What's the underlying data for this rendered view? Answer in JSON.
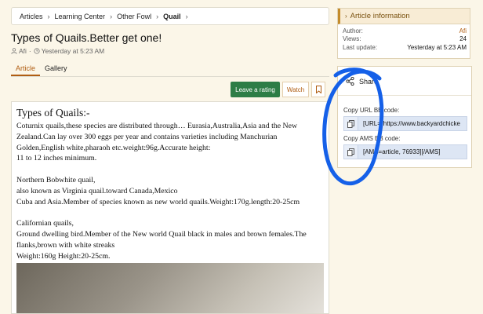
{
  "breadcrumb": {
    "items": [
      "Articles",
      "Learning Center",
      "Other Fowl"
    ],
    "current": "Quail"
  },
  "article": {
    "title": "Types of Quails.Better get one!",
    "author": "Afi",
    "date": "Yesterday at 5:23 AM",
    "tabs": [
      "Article",
      "Gallery"
    ],
    "buttons": {
      "rating": "Leave a rating",
      "watch": "Watch"
    },
    "body": {
      "heading": "Types of Quails:-",
      "paragraphs": [
        [
          "Coturnix quails,these species are distributed through… Eurasia,Australia,Asia and the New",
          "Zealand.Can lay over 300 eggs per year and contains varieties including Manchurian",
          "Golden,English white,pharaoh etc.weight:96g.Accurate height:",
          "11 to 12 inches minimum."
        ],
        [
          "Northern Bobwhite quail,",
          "also known as Virginia quail.toward Canada,Mexico",
          "Cuba and Asia.Member of species known as new world quails.Weight:170g.length:20-25cm"
        ],
        [
          "Californian quails,",
          "Ground dwelling bird.Member of the New world Quail black in males and brown females.The",
          "flanks,brown with white streaks",
          "Weight:160g Height:20-25cm."
        ]
      ]
    }
  },
  "sidebar": {
    "info": {
      "title": "Article information",
      "rows": [
        {
          "label": "Author:",
          "value": "Afi"
        },
        {
          "label": "Views:",
          "value": "24"
        },
        {
          "label": "Last update:",
          "value": "Yesterday at 5:23 AM"
        }
      ]
    },
    "share": {
      "title": "Share",
      "url_label": "Copy URL BB code:",
      "url_value": "[URL=\"https://www.backyardchicke",
      "ams_label": "Copy AMS BB code:",
      "ams_value": "[AMS=article, 76933][/AMS]"
    }
  },
  "colors": {
    "accent": "#b05d12",
    "rating_button": "#2d7d46",
    "page_bg": "#fbf6e8",
    "annotation_ink": "#1560e8"
  },
  "icons": [
    "user-icon",
    "clock-icon",
    "bookmark-icon",
    "share-icon",
    "copy-icon",
    "chevron-right-icon"
  ]
}
